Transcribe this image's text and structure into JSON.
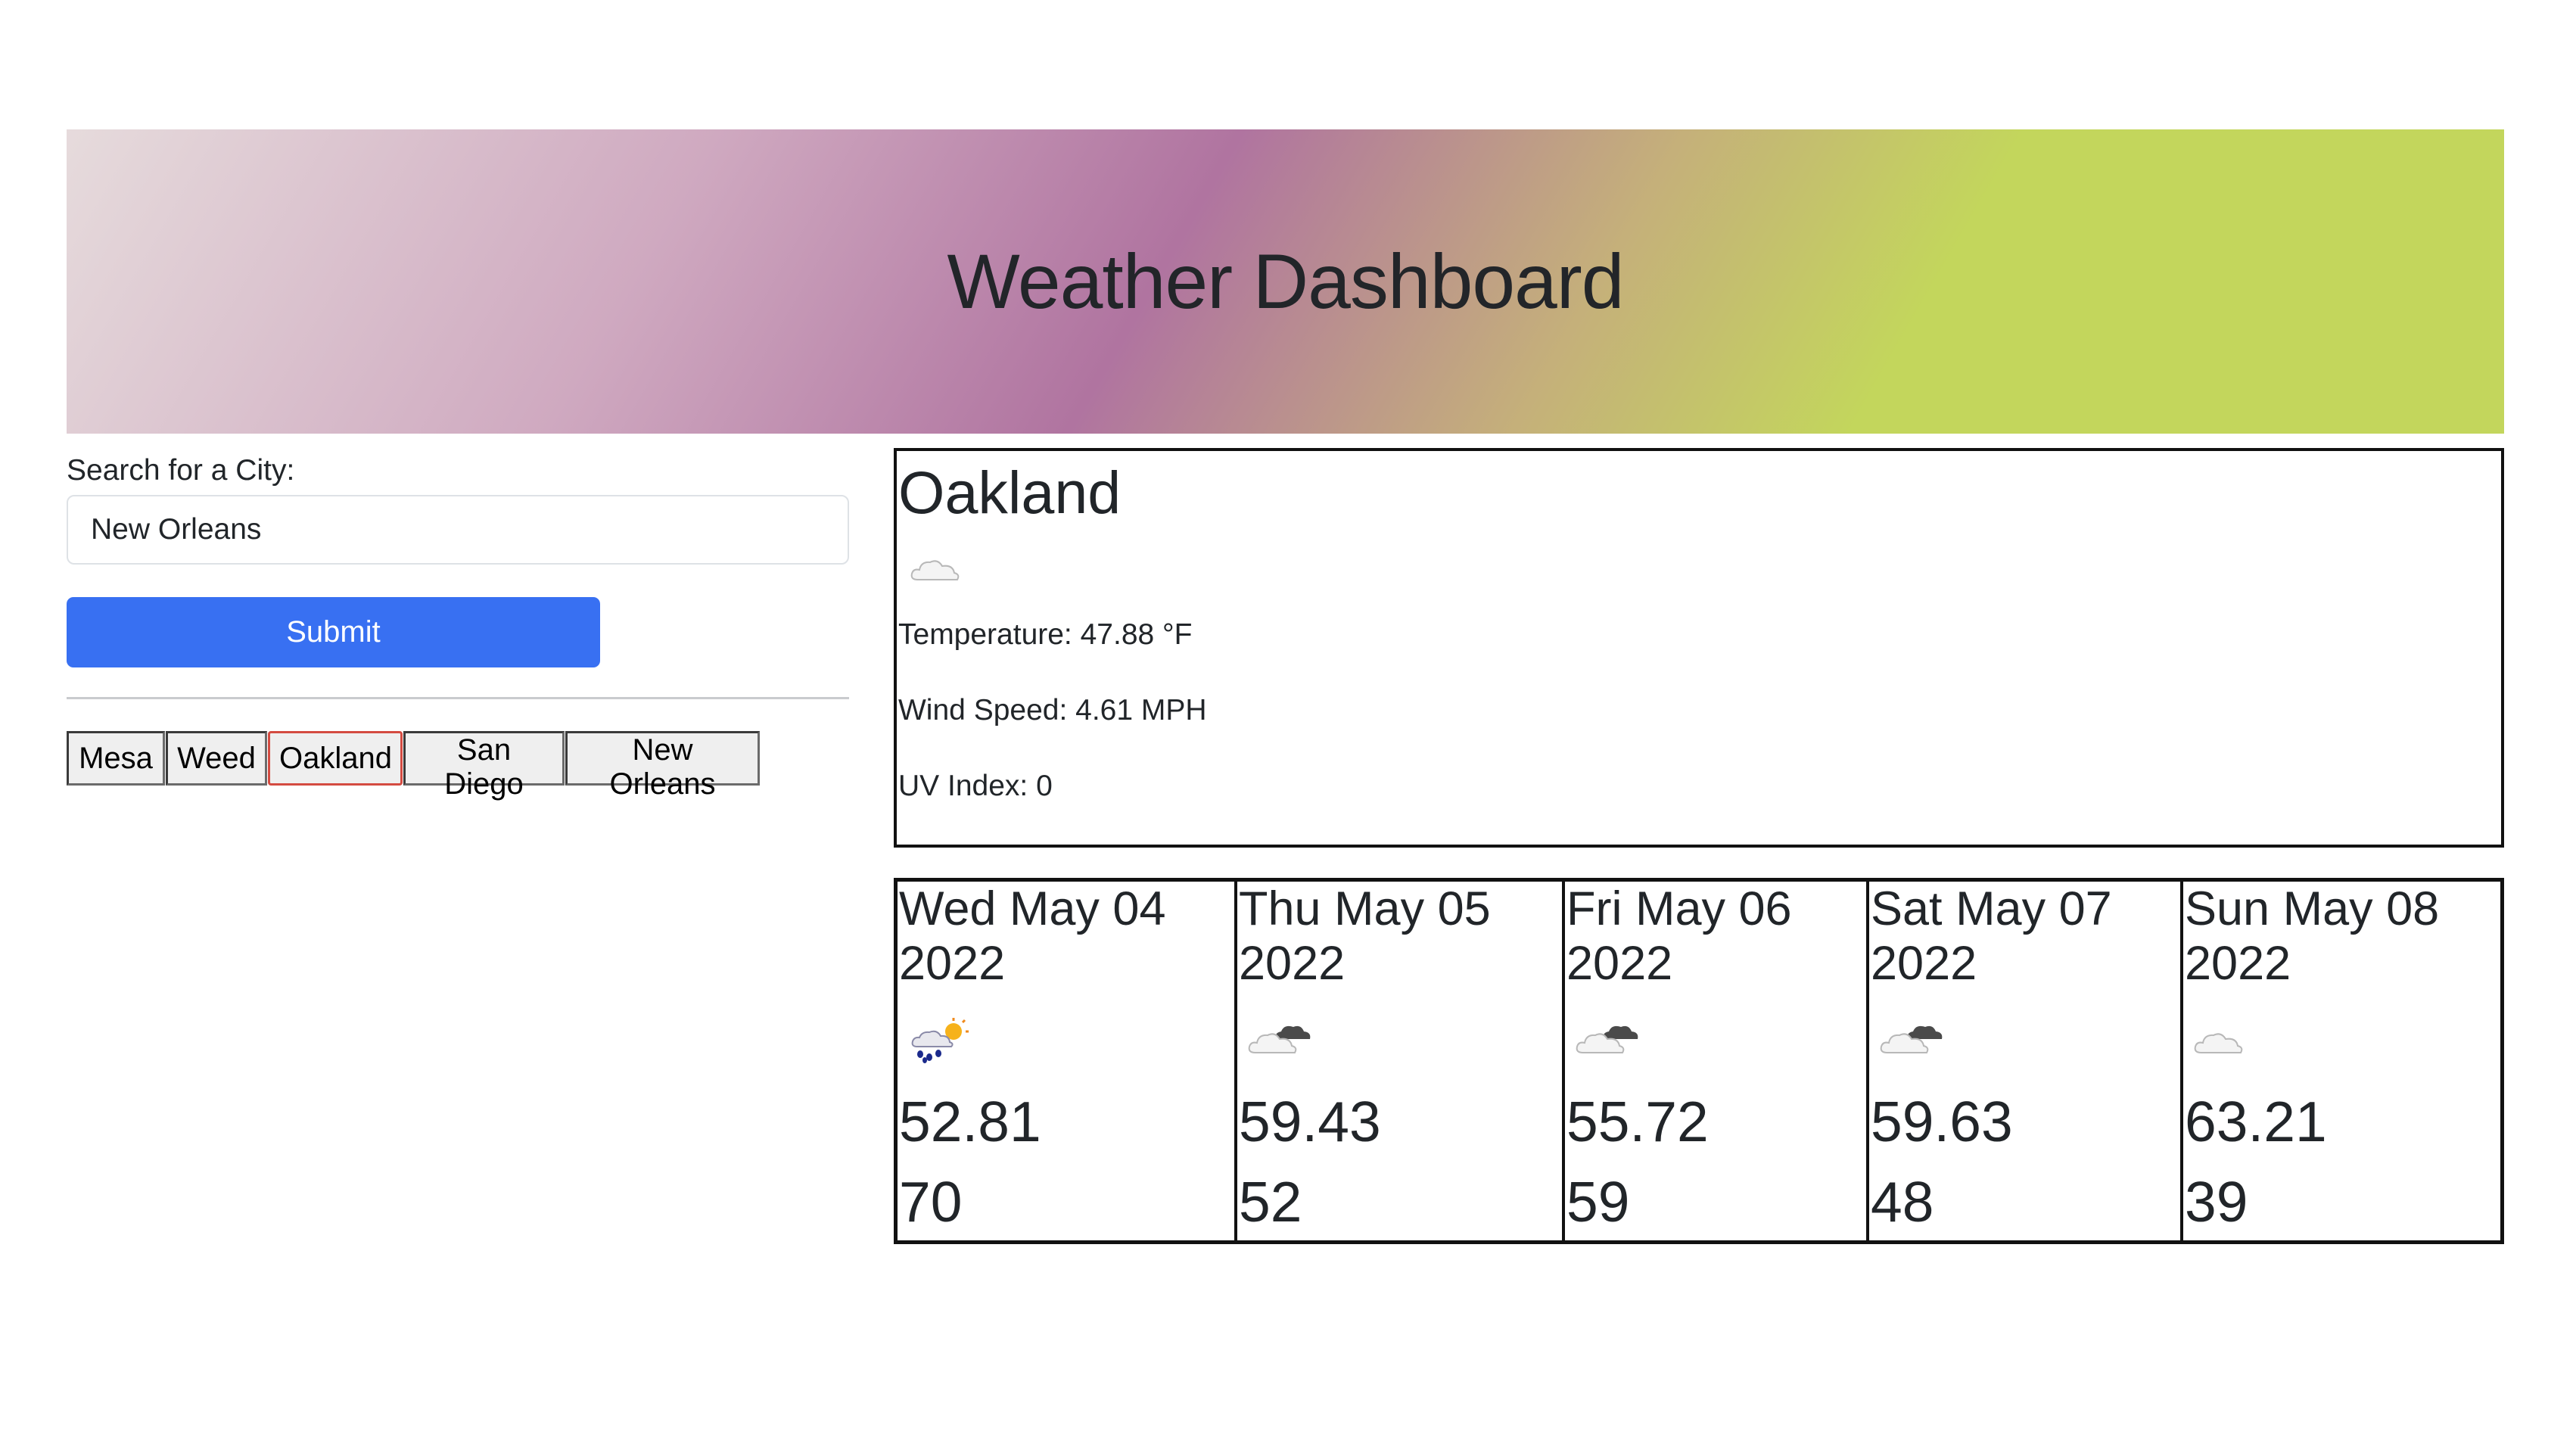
{
  "header": {
    "title": "Weather Dashboard"
  },
  "search": {
    "label": "Search for a City:",
    "value": "New Orleans",
    "submit_label": "Submit"
  },
  "history": [
    {
      "label": "Mesa",
      "active": false
    },
    {
      "label": "Weed",
      "active": false
    },
    {
      "label": "Oakland",
      "active": true
    },
    {
      "label": "San Diego",
      "active": false
    },
    {
      "label": "New Orleans",
      "active": false
    }
  ],
  "current": {
    "city": "Oakland",
    "icon": "cloud-icon",
    "temperature": "Temperature: 47.88 °F",
    "wind": "Wind Speed: 4.61 MPH",
    "uv": "UV Index: 0"
  },
  "forecast": [
    {
      "date": "Wed May 04\n2022",
      "icon": "rain-sun-icon",
      "temp": "52.81",
      "humidity": "70"
    },
    {
      "date": "Thu May 05\n2022",
      "icon": "dark-cloud-icon",
      "temp": "59.43",
      "humidity": "52"
    },
    {
      "date": "Fri May 06\n2022",
      "icon": "dark-cloud-icon",
      "temp": "55.72",
      "humidity": "59"
    },
    {
      "date": "Sat May 07\n2022",
      "icon": "dark-cloud-icon",
      "temp": "59.63",
      "humidity": "48"
    },
    {
      "date": "Sun May 08\n2022",
      "icon": "cloud-icon",
      "temp": "63.21",
      "humidity": "39"
    }
  ],
  "colors": {
    "submit": "#3870f2",
    "active_history_border": "#d44b41"
  }
}
